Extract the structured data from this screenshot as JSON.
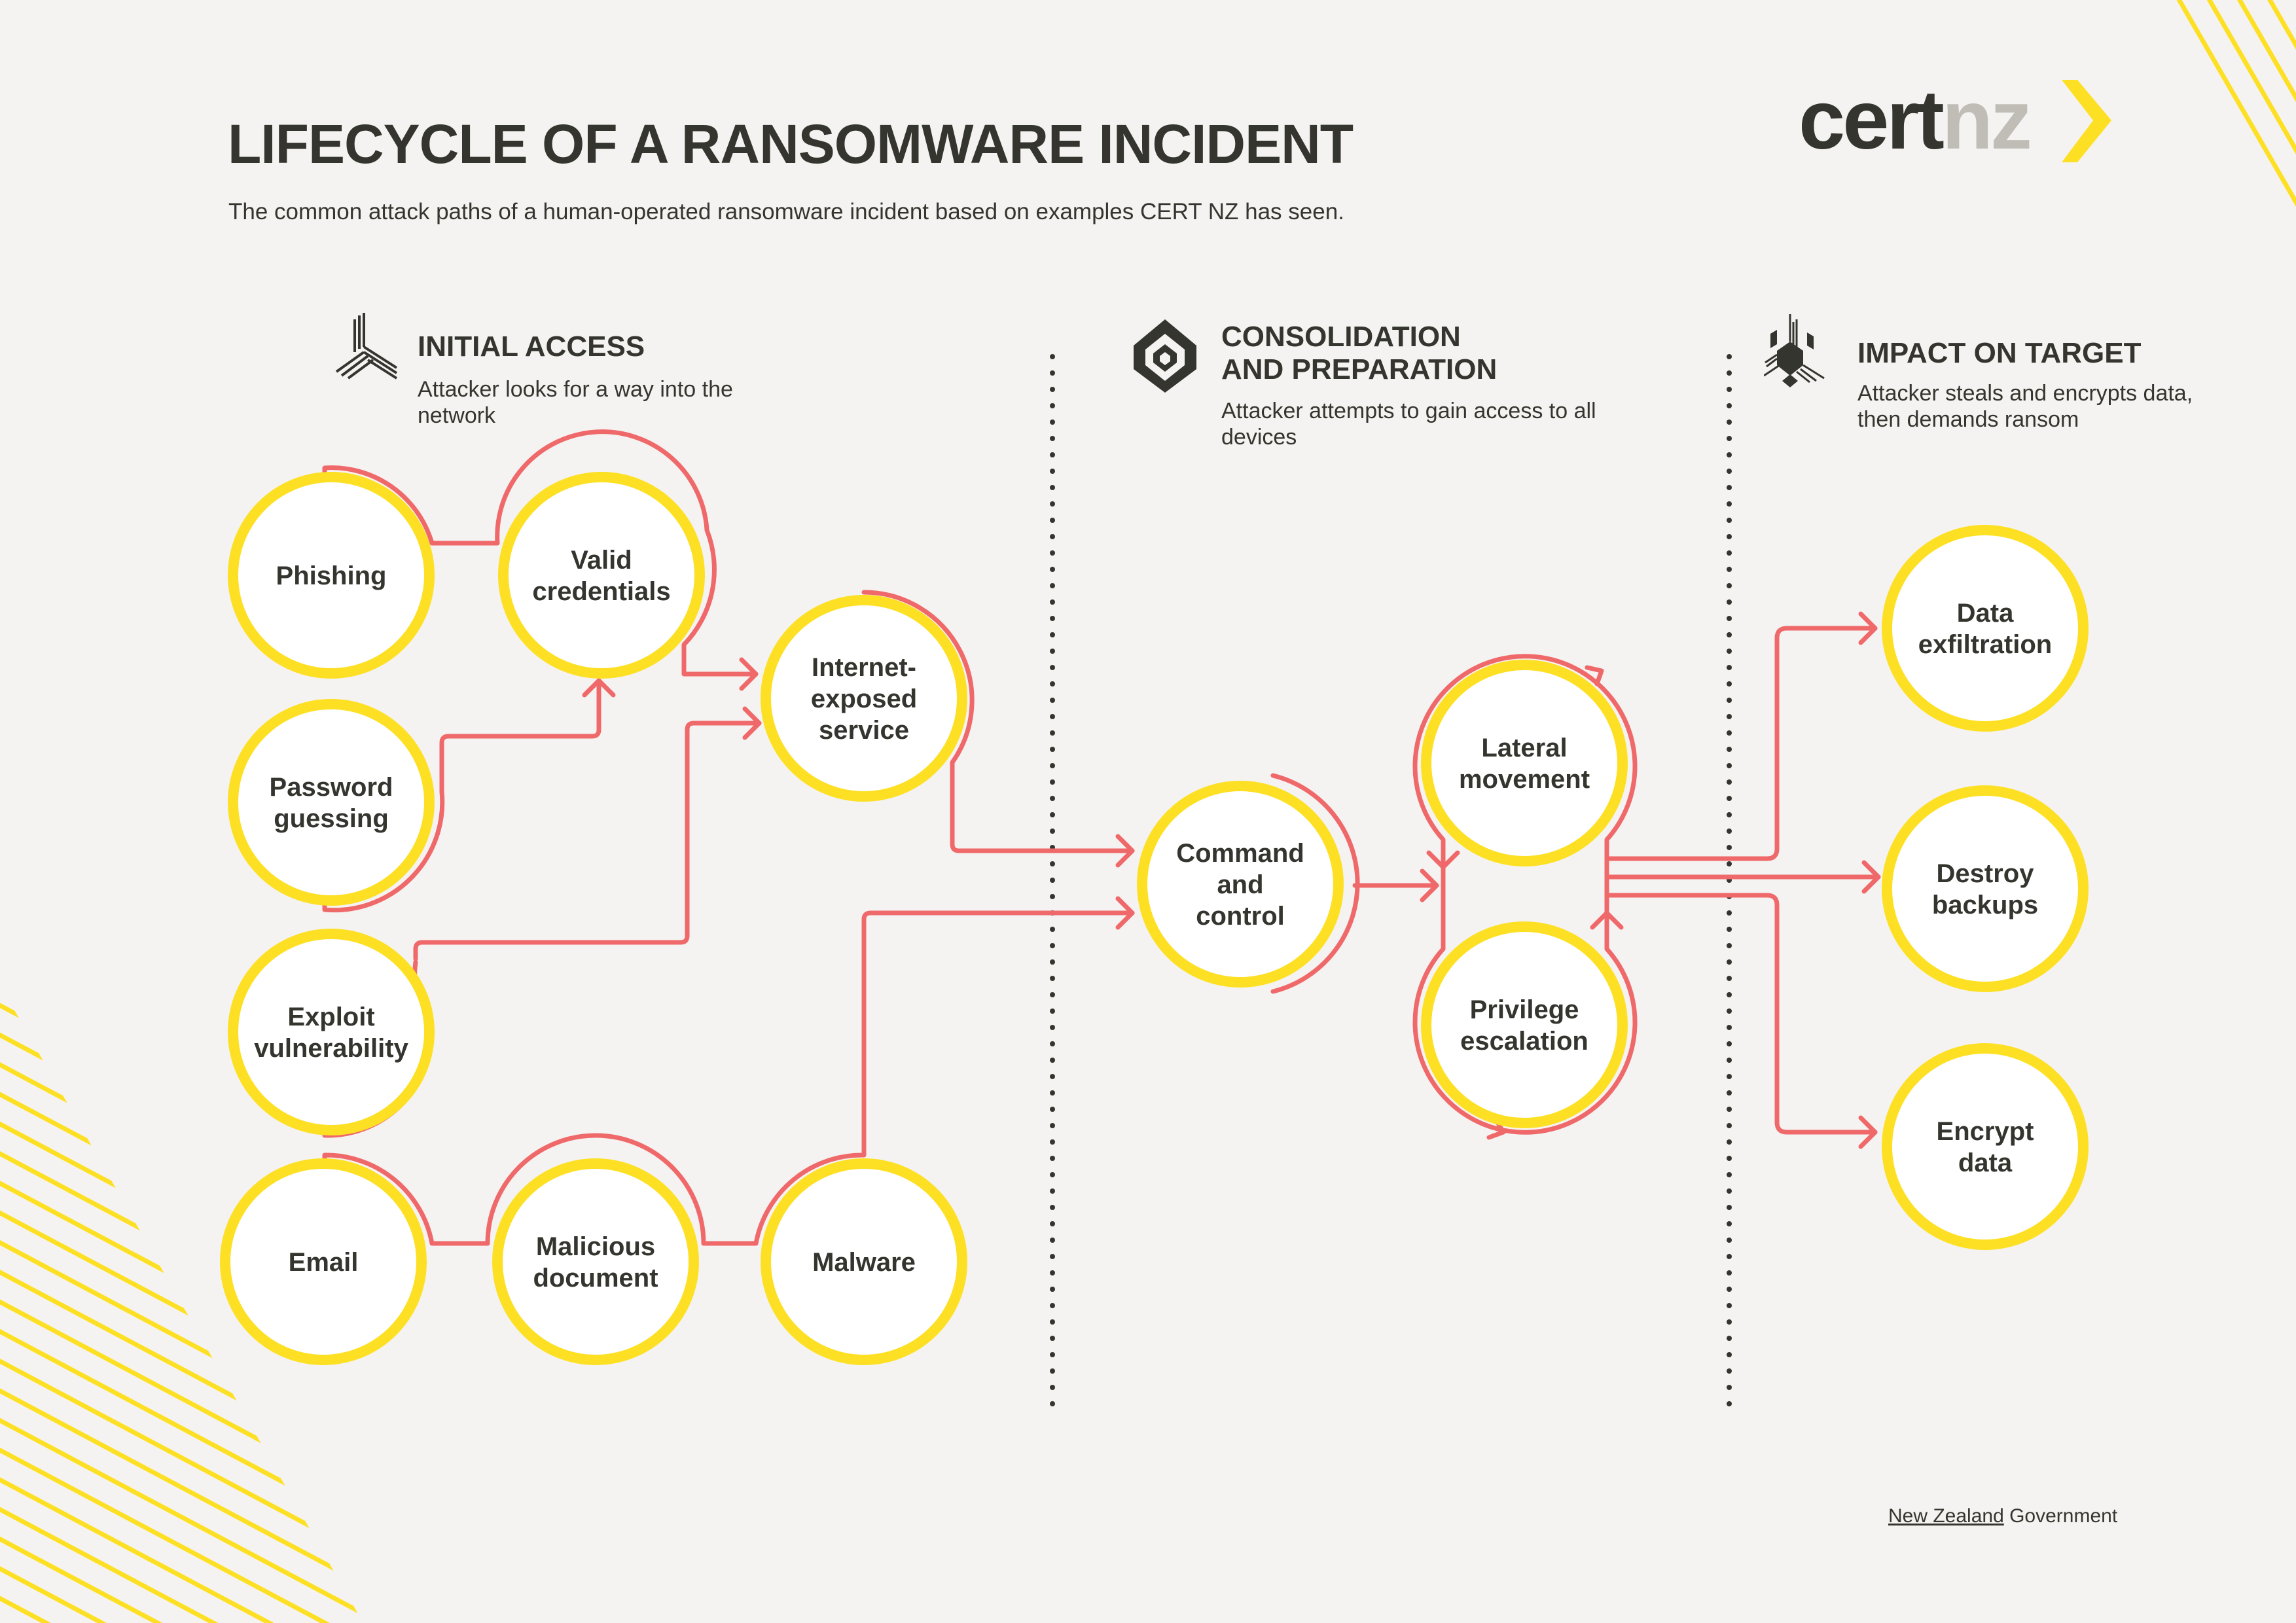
{
  "header": {
    "title": "LIFECYCLE OF A RANSOMWARE INCIDENT",
    "subtitle": "The common attack paths of a human-operated ransomware incident based on examples CERT NZ has seen.",
    "logo_part1": "cert",
    "logo_part2": "nz",
    "logo_icon": "chevron-right-icon"
  },
  "colors": {
    "background": "#f4f3f1",
    "ring": "#fde024",
    "path": "#f0696a",
    "text": "#35352f",
    "logo_grey": "#bfbdb6"
  },
  "phases": [
    {
      "title_lines": [
        "INITIAL ACCESS"
      ],
      "description": "Attacker looks for a way into the network",
      "icon": "branching-lines-icon"
    },
    {
      "title_lines": [
        "CONSOLIDATION",
        "AND PREPARATION"
      ],
      "description": "Attacker attempts to gain access to all devices",
      "icon": "nested-hexagon-icon"
    },
    {
      "title_lines": [
        "IMPACT ON TARGET"
      ],
      "description": "Attacker steals and encrypts data, then demands ransom",
      "icon": "exploding-hexagon-icon"
    }
  ],
  "nodes": {
    "phishing": [
      "Phishing"
    ],
    "valid_credentials": [
      "Valid",
      "credentials"
    ],
    "password_guessing": [
      "Password",
      "guessing"
    ],
    "internet_exposed": [
      "Internet-",
      "exposed",
      "service"
    ],
    "exploit_vulnerability": [
      "Exploit",
      "vulnerability"
    ],
    "email": [
      "Email"
    ],
    "malicious_document": [
      "Malicious",
      "document"
    ],
    "malware": [
      "Malware"
    ],
    "command_control": [
      "Command",
      "and",
      "control"
    ],
    "lateral_movement": [
      "Lateral",
      "movement"
    ],
    "privilege_escalation": [
      "Privilege",
      "escalation"
    ],
    "data_exfiltration": [
      "Data",
      "exfiltration"
    ],
    "destroy_backups": [
      "Destroy",
      "backups"
    ],
    "encrypt_data": [
      "Encrypt",
      "data"
    ]
  },
  "edges": [
    [
      "phishing",
      "valid_credentials"
    ],
    [
      "password_guessing",
      "valid_credentials"
    ],
    [
      "valid_credentials",
      "internet_exposed"
    ],
    [
      "exploit_vulnerability",
      "internet_exposed"
    ],
    [
      "email",
      "malicious_document"
    ],
    [
      "malicious_document",
      "malware"
    ],
    [
      "internet_exposed",
      "command_control"
    ],
    [
      "malware",
      "command_control"
    ],
    [
      "command_control",
      "lateral_movement"
    ],
    [
      "lateral_movement",
      "privilege_escalation"
    ],
    [
      "privilege_escalation",
      "lateral_movement"
    ],
    [
      "lateral_movement",
      "data_exfiltration"
    ],
    [
      "lateral_movement",
      "destroy_backups"
    ],
    [
      "lateral_movement",
      "encrypt_data"
    ]
  ],
  "footer": {
    "gov_part1": "New Zealand",
    "gov_part2": " Government"
  }
}
